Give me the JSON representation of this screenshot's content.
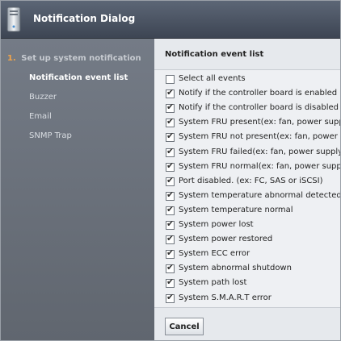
{
  "window": {
    "title": "Notification Dialog"
  },
  "sidebar": {
    "step_number": "1.",
    "step_label": "Set up system notification",
    "items": [
      {
        "label": "Notification event list",
        "active": true
      },
      {
        "label": "Buzzer",
        "active": false
      },
      {
        "label": "Email",
        "active": false
      },
      {
        "label": "SNMP Trap",
        "active": false
      }
    ]
  },
  "panel": {
    "title": "Notification event list",
    "events": [
      {
        "label": "Select all events",
        "checked": false
      },
      {
        "label": "Notify if the controller board is enabled",
        "checked": true
      },
      {
        "label": "Notify if the controller board is disabled",
        "checked": true
      },
      {
        "label": "System FRU present(ex: fan, power supply, co",
        "checked": true
      },
      {
        "label": "System FRU not present(ex: fan, power supply",
        "checked": true
      },
      {
        "label": "System FRU failed(ex: fan, power supply, cont",
        "checked": true
      },
      {
        "label": "System FRU normal(ex: fan, power supply, cor",
        "checked": true
      },
      {
        "label": "Port disabled. (ex: FC, SAS or iSCSI)",
        "checked": true
      },
      {
        "label": "System temperature abnormal detected",
        "checked": true
      },
      {
        "label": "System temperature normal",
        "checked": true
      },
      {
        "label": "System power lost",
        "checked": true
      },
      {
        "label": "System power restored",
        "checked": true
      },
      {
        "label": "System ECC error",
        "checked": true
      },
      {
        "label": "System abnormal shutdown",
        "checked": true
      },
      {
        "label": "System path lost",
        "checked": true
      },
      {
        "label": "System S.M.A.R.T error",
        "checked": true
      }
    ],
    "cancel_label": "Cancel"
  }
}
